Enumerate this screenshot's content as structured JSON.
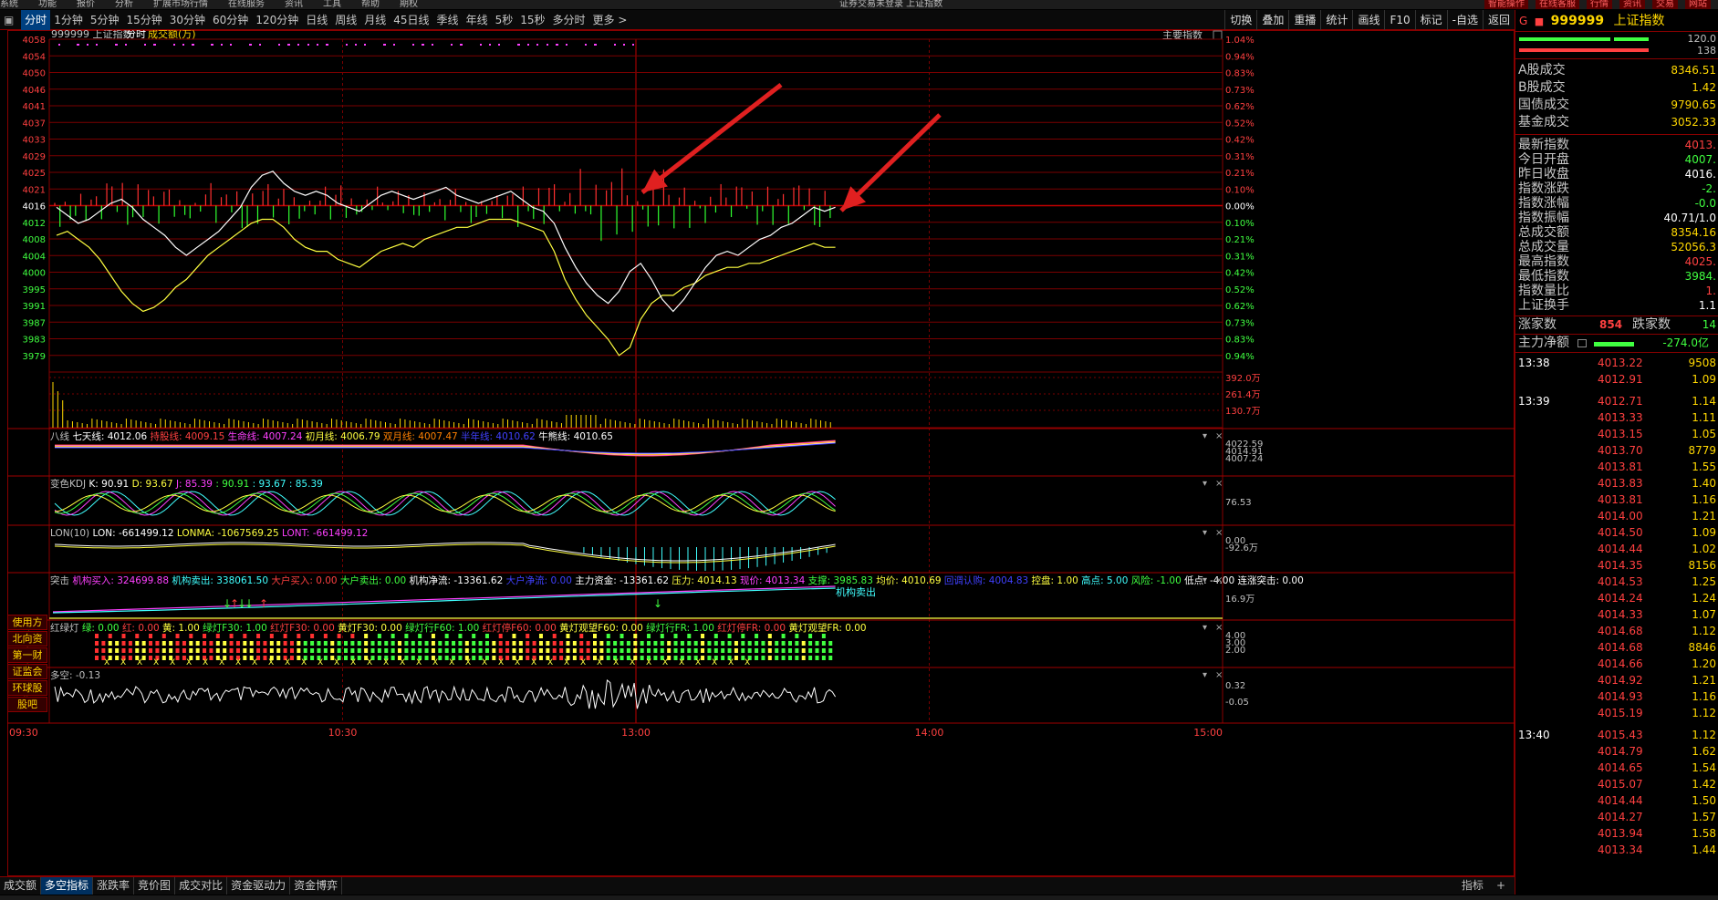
{
  "menubar": {
    "items": [
      "系统",
      "功能",
      "报价",
      "分析",
      "扩展市场行情",
      "在线服务",
      "资讯",
      "工具",
      "帮助",
      "期权"
    ],
    "center": "证券交易未登录 上证指数",
    "right": [
      "智能操作",
      "在线客服",
      "行情",
      "资讯",
      "交易",
      "网站"
    ]
  },
  "periods": [
    "分时",
    "1分钟",
    "5分钟",
    "15分钟",
    "30分钟",
    "60分钟",
    "120分钟",
    "日线",
    "周线",
    "月线",
    "45日线",
    "季线",
    "年线",
    "5秒",
    "15秒",
    "多分时",
    "更多 >"
  ],
  "tools": [
    "切换",
    "叠加",
    "重播",
    "统计",
    "画线",
    "F10",
    "标记",
    "-自选",
    "返回"
  ],
  "chart_header": {
    "code": "999999 上证指数",
    "mode": "分时",
    "sub": "成交额(万)",
    "main_label": "主要指数"
  },
  "chart_data": {
    "type": "line",
    "yaxis_left": [
      "4058",
      "4054",
      "4050",
      "4046",
      "4041",
      "4037",
      "4033",
      "4029",
      "4025",
      "4021",
      "4016",
      "4012",
      "4008",
      "4004",
      "4000",
      "3995",
      "3991",
      "3987",
      "3983",
      "3979"
    ],
    "yaxis_right": [
      "1.04%",
      "0.94%",
      "0.83%",
      "0.73%",
      "0.62%",
      "0.52%",
      "0.42%",
      "0.31%",
      "0.21%",
      "0.10%",
      "0.00%",
      "0.10%",
      "0.21%",
      "0.31%",
      "0.42%",
      "0.52%",
      "0.62%",
      "0.73%",
      "0.83%",
      "0.94%"
    ],
    "vol_labels": [
      "392.0万",
      "261.4万",
      "130.7万"
    ],
    "xlabels": [
      "09:30",
      "10:30",
      "13:00",
      "14:00",
      "15:00"
    ],
    "prev_close": 4016.4,
    "white": [
      4016,
      4014,
      4012,
      4013,
      4015,
      4017,
      4018,
      4016,
      4013,
      4011,
      4009,
      4006,
      4004,
      4006,
      4008,
      4010,
      4013,
      4016,
      4021,
      4024,
      4025,
      4022,
      4020,
      4019,
      4020,
      4019,
      4017,
      4016,
      4015,
      4017,
      4019,
      4020,
      4019,
      4018,
      4019,
      4020,
      4021,
      4019,
      4018,
      4017,
      4018,
      4019,
      4020,
      4018,
      4016,
      4015,
      4012,
      4006,
      4001,
      3997,
      3994,
      3992,
      3995,
      4000,
      4002,
      3998,
      3993,
      3990,
      3993,
      3997,
      4001,
      4004,
      4005,
      4004,
      4006,
      4008,
      4009,
      4011,
      4012,
      4014,
      4016,
      4015,
      4016
    ],
    "yellow": [
      4009,
      4010,
      4008,
      4006,
      4003,
      3999,
      3995,
      3992,
      3990,
      3991,
      3993,
      3996,
      3998,
      4001,
      4004,
      4006,
      4008,
      4010,
      4012,
      4013,
      4013,
      4011,
      4008,
      4006,
      4005,
      4005,
      4003,
      4002,
      4001,
      4003,
      4005,
      4006,
      4007,
      4006,
      4008,
      4009,
      4010,
      4011,
      4011,
      4012,
      4013,
      4013,
      4013,
      4012,
      4011,
      4010,
      4005,
      3998,
      3993,
      3989,
      3986,
      3983,
      3979,
      3981,
      3988,
      3992,
      3994,
      3994,
      3996,
      3997,
      3999,
      4000,
      4001,
      4001,
      4002,
      4002,
      4003,
      4004,
      4005,
      4006,
      4007,
      4006,
      4006
    ]
  },
  "indicators": {
    "ma": {
      "title": "八线",
      "items": [
        {
          "t": "七天线: 4012.06",
          "c": "#ffffff"
        },
        {
          "t": "持股线: 4009.15",
          "c": "#ff4040"
        },
        {
          "t": "生命线: 4007.24",
          "c": "#ff40ff"
        },
        {
          "t": "初月线: 4006.79",
          "c": "#ffff40"
        },
        {
          "t": "双月线: 4007.47",
          "c": "#ff8000"
        },
        {
          "t": "半年线: 4010.62",
          "c": "#4040ff"
        },
        {
          "t": "牛熊线: 4010.65",
          "c": "#ffffff"
        }
      ],
      "scale": [
        "4022.59",
        "4014.91",
        "4007.24"
      ]
    },
    "kdj": {
      "title": "变色KDJ",
      "items": [
        {
          "t": "K: 90.91",
          "c": "#ffffff"
        },
        {
          "t": "D: 93.67",
          "c": "#ffff40"
        },
        {
          "t": "J: 85.39",
          "c": "#ff40ff"
        },
        {
          "t": ": 90.91",
          "c": "#40ff40"
        },
        {
          "t": ": 93.67",
          "c": "#40ffff"
        },
        {
          "t": ": 85.39",
          "c": "#40ffff"
        }
      ],
      "scale": [
        "76.53"
      ]
    },
    "lon": {
      "title": "LON(10)",
      "items": [
        {
          "t": "LON: -661499.12",
          "c": "#ffffff"
        },
        {
          "t": "LONMA: -1067569.25",
          "c": "#ffff40"
        },
        {
          "t": "LONT: -661499.12",
          "c": "#ff40ff"
        }
      ],
      "scale": [
        "0.00",
        "-92.6万"
      ]
    },
    "attack": {
      "title": "突击",
      "items": [
        {
          "t": "机构买入: 324699.88",
          "c": "#ff40ff"
        },
        {
          "t": "机构卖出: 338061.50",
          "c": "#40ffff"
        },
        {
          "t": "大户买入: 0.00",
          "c": "#ff4040"
        },
        {
          "t": "大户卖出: 0.00",
          "c": "#40ff40"
        },
        {
          "t": "机构净流: -13361.62",
          "c": "#ffffff"
        },
        {
          "t": "大户净流: 0.00",
          "c": "#4040ff"
        },
        {
          "t": "主力资金: -13361.62",
          "c": "#ffffff"
        },
        {
          "t": "压力: 4014.13",
          "c": "#ffff40"
        },
        {
          "t": "现价: 4013.34",
          "c": "#ff40ff"
        },
        {
          "t": "支撑: 3985.83",
          "c": "#40ff40"
        },
        {
          "t": "均价: 4010.69",
          "c": "#ffff40"
        },
        {
          "t": "回调认购: 4004.83",
          "c": "#4040ff"
        },
        {
          "t": "控盘: 1.00",
          "c": "#ffff40"
        },
        {
          "t": "高点: 5.00",
          "c": "#40ffff"
        },
        {
          "t": "风险: -1.00",
          "c": "#40ff40"
        },
        {
          "t": "低点: -4.00",
          "c": "#ffffff"
        },
        {
          "t": "连涨突击: 0.00",
          "c": "#ffffff"
        }
      ],
      "scale": [
        "16.9万"
      ],
      "label": "机构卖出"
    },
    "light": {
      "title": "红绿灯",
      "items": [
        {
          "t": "绿: 0.00",
          "c": "#40ff40"
        },
        {
          "t": "红: 0.00",
          "c": "#ff4040"
        },
        {
          "t": "黄: 1.00",
          "c": "#ffff40"
        },
        {
          "t": "绿灯F30: 1.00",
          "c": "#40ff40"
        },
        {
          "t": "红灯F30: 0.00",
          "c": "#ff4040"
        },
        {
          "t": "黄灯F30: 0.00",
          "c": "#ffff40"
        },
        {
          "t": "绿灯行F60: 1.00",
          "c": "#40ff40"
        },
        {
          "t": "红灯停F60: 0.00",
          "c": "#ff4040"
        },
        {
          "t": "黄灯观望F60: 0.00",
          "c": "#ffff40"
        },
        {
          "t": "绿灯行FR: 1.00",
          "c": "#40ff40"
        },
        {
          "t": "红灯停FR: 0.00",
          "c": "#ff4040"
        },
        {
          "t": "黄灯观望FR: 0.00",
          "c": "#ffff40"
        }
      ],
      "scale": [
        "4.00",
        "3.00",
        "2.00"
      ]
    },
    "duokong": {
      "title": "多空: -0.13",
      "scale": [
        "0.32",
        "-0.05"
      ]
    }
  },
  "sidebuttons": [
    "使用方法",
    "北向资金",
    "第一财金",
    "证监会",
    "环球股指",
    "股吧"
  ],
  "bottom_tabs": [
    "成交额",
    "多空指标",
    "涨跌率",
    "竞价图",
    "成交对比",
    "资金驱动力",
    "资金博弈"
  ],
  "bottom_right": [
    "指标",
    "+"
  ],
  "rpanel": {
    "code": "999999",
    "name": "上证指数",
    "bar_vals": [
      "120.0",
      "138"
    ],
    "rows1": [
      {
        "k": "A股成交",
        "v": "8346.51"
      },
      {
        "k": "B股成交",
        "v": "1.42"
      },
      {
        "k": "国债成交",
        "v": "9790.65"
      },
      {
        "k": "基金成交",
        "v": "3052.33"
      }
    ],
    "rows2": [
      {
        "k": "最新指数",
        "v": "4013.",
        "c": "#ff4040"
      },
      {
        "k": "今日开盘",
        "v": "4007.",
        "c": "#40ff40"
      },
      {
        "k": "昨日收盘",
        "v": "4016.",
        "c": "#ffffff"
      },
      {
        "k": "指数涨跌",
        "v": "-2.",
        "c": "#40ff40"
      },
      {
        "k": "指数涨幅",
        "v": "-0.0",
        "c": "#40ff40"
      },
      {
        "k": "指数振幅",
        "v": "40.71/1.0",
        "c": "#ffffff"
      },
      {
        "k": "总成交额",
        "v": "8354.16",
        "c": "#ffd700"
      },
      {
        "k": "总成交量",
        "v": "52056.3",
        "c": "#ffd700"
      },
      {
        "k": "最高指数",
        "v": "4025.",
        "c": "#ff4040"
      },
      {
        "k": "最低指数",
        "v": "3984.",
        "c": "#40ff40"
      },
      {
        "k": "指数量比",
        "v": "1.",
        "c": "#ff4040"
      },
      {
        "k": "上证换手",
        "v": "1.1",
        "c": "#ffffff"
      }
    ],
    "updown": {
      "up_label": "涨家数",
      "up": "854",
      "down_label": "跌家数",
      "down": "14"
    },
    "mainflow": {
      "k": "主力净额",
      "v": "-274.0亿"
    },
    "ticks": [
      {
        "t": "13:38",
        "p": "4013.22",
        "q": "9508"
      },
      {
        "t": "",
        "p": "4012.91",
        "q": "1.09"
      },
      {
        "t": "13:39",
        "p": "4012.71",
        "q": "1.14"
      },
      {
        "t": "",
        "p": "4013.33",
        "q": "1.11"
      },
      {
        "t": "",
        "p": "4013.15",
        "q": "1.05"
      },
      {
        "t": "",
        "p": "4013.70",
        "q": "8779"
      },
      {
        "t": "",
        "p": "4013.81",
        "q": "1.55"
      },
      {
        "t": "",
        "p": "4013.83",
        "q": "1.40"
      },
      {
        "t": "",
        "p": "4013.81",
        "q": "1.16"
      },
      {
        "t": "",
        "p": "4014.00",
        "q": "1.21"
      },
      {
        "t": "",
        "p": "4014.50",
        "q": "1.09"
      },
      {
        "t": "",
        "p": "4014.44",
        "q": "1.02"
      },
      {
        "t": "",
        "p": "4014.35",
        "q": "8156"
      },
      {
        "t": "",
        "p": "4014.53",
        "q": "1.25"
      },
      {
        "t": "",
        "p": "4014.24",
        "q": "1.24"
      },
      {
        "t": "",
        "p": "4014.33",
        "q": "1.07"
      },
      {
        "t": "",
        "p": "4014.68",
        "q": "1.12"
      },
      {
        "t": "",
        "p": "4014.68",
        "q": "8846"
      },
      {
        "t": "",
        "p": "4014.66",
        "q": "1.20"
      },
      {
        "t": "",
        "p": "4014.92",
        "q": "1.21"
      },
      {
        "t": "",
        "p": "4014.93",
        "q": "1.16"
      },
      {
        "t": "",
        "p": "4015.19",
        "q": "1.12"
      },
      {
        "t": "13:40",
        "p": "4015.43",
        "q": "1.12"
      },
      {
        "t": "",
        "p": "4014.79",
        "q": "1.62"
      },
      {
        "t": "",
        "p": "4014.65",
        "q": "1.54"
      },
      {
        "t": "",
        "p": "4015.07",
        "q": "1.42"
      },
      {
        "t": "",
        "p": "4014.44",
        "q": "1.50"
      },
      {
        "t": "",
        "p": "4014.27",
        "q": "1.57"
      },
      {
        "t": "",
        "p": "4013.94",
        "q": "1.58"
      },
      {
        "t": "",
        "p": "4013.34",
        "q": "1.44"
      }
    ]
  }
}
